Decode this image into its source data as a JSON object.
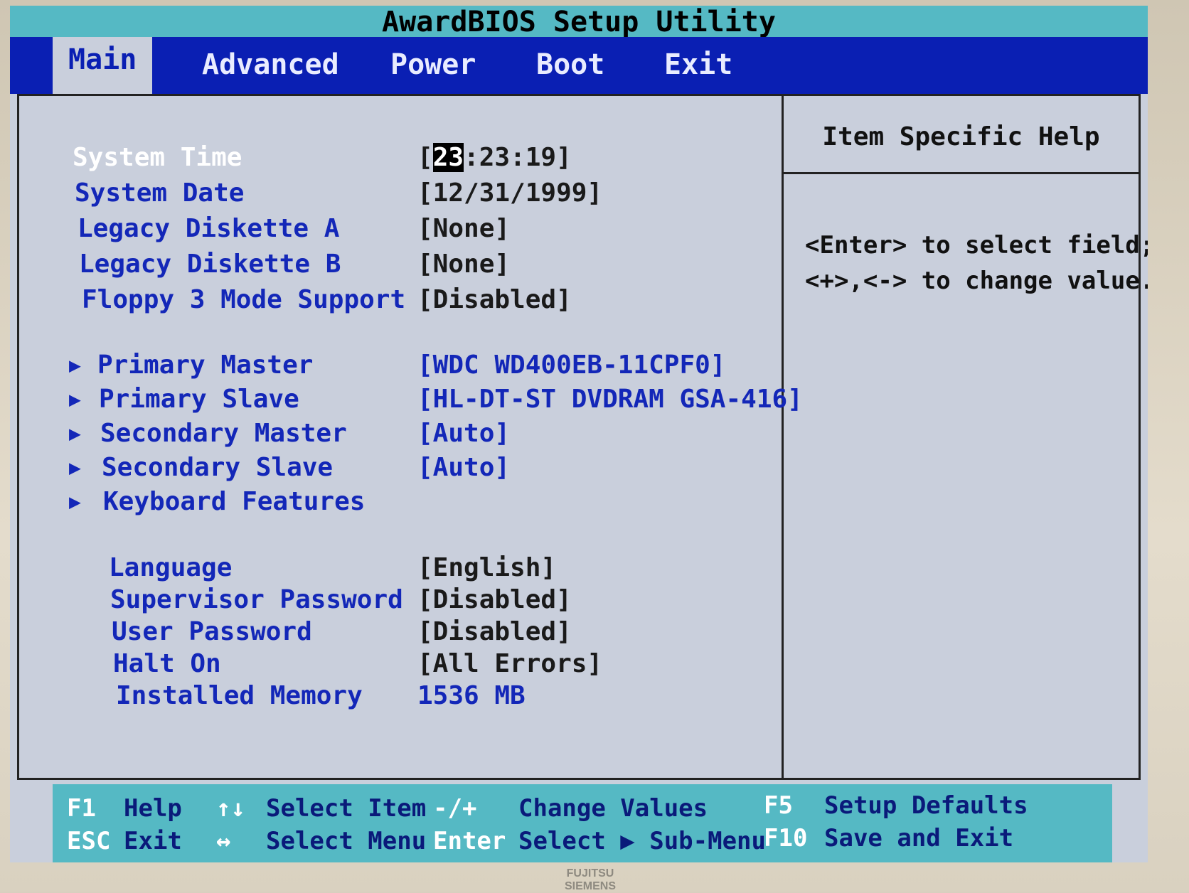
{
  "window": {
    "title": "AwardBIOS Setup Utility"
  },
  "menu": {
    "items": [
      "Main",
      "Advanced",
      "Power",
      "Boot",
      "Exit"
    ]
  },
  "settings": [
    {
      "label": "System Time",
      "value_prefix": "[",
      "value_cursor": "23",
      "value_suffix": ":23:19]"
    },
    {
      "label": "System Date",
      "value": "[12/31/1999]"
    },
    {
      "label": "Legacy Diskette A",
      "value": "[None]"
    },
    {
      "label": "Legacy Diskette B",
      "value": "[None]"
    },
    {
      "label": "Floppy 3 Mode Support",
      "value": "[Disabled]"
    },
    {
      "label": "Primary Master",
      "value": "[WDC WD400EB-11CPF0]"
    },
    {
      "label": "Primary Slave",
      "value": "[HL-DT-ST DVDRAM GSA-416]"
    },
    {
      "label": "Secondary Master",
      "value": "[Auto]"
    },
    {
      "label": "Secondary Slave",
      "value": "[Auto]"
    },
    {
      "label": "Keyboard Features",
      "value": ""
    },
    {
      "label": "Language",
      "value": "[English]"
    },
    {
      "label": "Supervisor Password",
      "value": "[Disabled]"
    },
    {
      "label": "User Password",
      "value": "[Disabled]"
    },
    {
      "label": "Halt On",
      "value": "[All Errors]"
    },
    {
      "label": "Installed Memory",
      "value": "1536 MB"
    }
  ],
  "submenu_caret": "▶",
  "help": {
    "title": "Item Specific Help",
    "lines": [
      "<Enter> to select field;",
      "<+>,<-> to change value."
    ]
  },
  "footer": {
    "f1": {
      "key": "F1",
      "desc": "Help"
    },
    "esc": {
      "key": "ESC",
      "desc": "Exit"
    },
    "updown": {
      "key": "↑↓",
      "desc": "Select Item"
    },
    "leftright": {
      "key": "↔",
      "desc": "Select Menu"
    },
    "plusminus": {
      "key": "-/+",
      "desc": "Change Values"
    },
    "enter": {
      "key": "Enter",
      "desc": "Select ▶ Sub-Menu"
    },
    "f5": {
      "key": "F5",
      "desc": "Setup Defaults"
    },
    "f10": {
      "key": "F10",
      "desc": "Save and Exit"
    }
  },
  "brand": {
    "text": "FUJITSU SIEMENS"
  },
  "colors": {
    "menu_bar": "#0a1fb3",
    "title_bar": "#55b9c4",
    "panel_bg": "#c9cfdc",
    "label_blue": "#1327b8"
  }
}
